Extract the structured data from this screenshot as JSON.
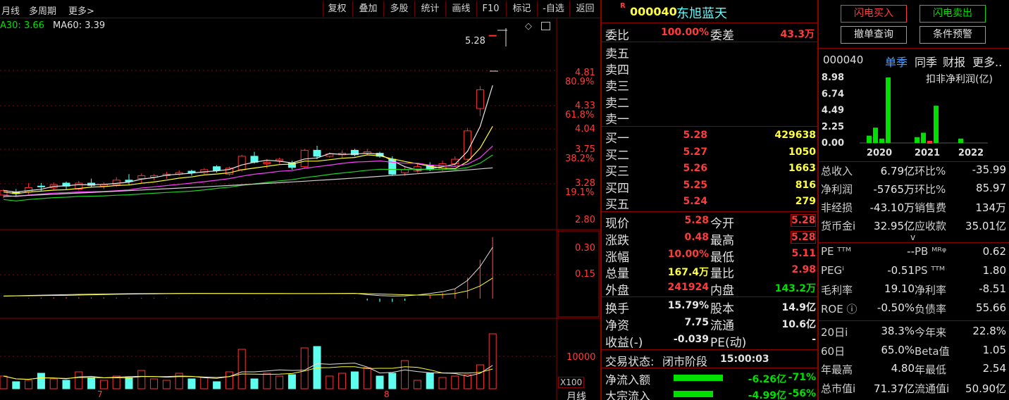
{
  "toolbar": {
    "left": [
      "月线",
      "多周期",
      "更多>"
    ],
    "buttons": [
      "复权",
      "叠加",
      "多股",
      "统计",
      "画线",
      "F10",
      "标记",
      "-自选",
      "返回"
    ]
  },
  "chart": {
    "ma_legend": [
      {
        "label": "A30: 3.66",
        "color": "#00e000"
      },
      {
        "label": "MA60: 3.39",
        "color": "#e0e0e0"
      }
    ],
    "high_mark": "5.28",
    "price_axis": [
      {
        "v": "4.81",
        "p": "80.9%"
      },
      {
        "v": "4.33",
        "p": "61.8%"
      },
      {
        "v": "4.04",
        "p": ""
      },
      {
        "v": "3.75",
        "p": "38.2%"
      },
      {
        "v": "3.28",
        "p": "19.1%"
      },
      {
        "v": "2.80",
        "p": ""
      }
    ],
    "mid_axis": [
      "0.30",
      "0.15"
    ],
    "vol_axis": "10000",
    "vol_unit": "X100",
    "x_labels": [
      "7",
      "8"
    ],
    "period_tag": "月线",
    "colors": {
      "up": "#ff3232",
      "down": "#5ffff0",
      "ma_white": "#e8e8e8",
      "ma_yellow": "#ffff30",
      "ma_magenta": "#ff40ff",
      "ma_green": "#20d020"
    }
  },
  "quote": {
    "badge": "R",
    "code": "000040",
    "name": "东旭蓝天",
    "weibi_label": "委比",
    "weibi_value": "100.00%",
    "weicha_label": "委差",
    "weicha_value": "43.3万",
    "sells": [
      "卖五",
      "卖四",
      "卖三",
      "卖二",
      "卖一"
    ],
    "buys": [
      {
        "label": "买一",
        "price": "5.28",
        "vol": "429638"
      },
      {
        "label": "买二",
        "price": "5.27",
        "vol": "1050"
      },
      {
        "label": "买三",
        "price": "5.26",
        "vol": "1663"
      },
      {
        "label": "买四",
        "price": "5.25",
        "vol": "816"
      },
      {
        "label": "买五",
        "price": "5.24",
        "vol": "279"
      }
    ],
    "stats_left": [
      {
        "k": "现价",
        "v": "5.28"
      },
      {
        "k": "涨跌",
        "v": "0.48"
      },
      {
        "k": "涨幅",
        "v": "10.00%"
      },
      {
        "k": "总量",
        "v": "167.4万"
      },
      {
        "k": "外盘",
        "v": "241924"
      }
    ],
    "stats_right": [
      {
        "k": "今开",
        "v": "5.28"
      },
      {
        "k": "最高",
        "v": "5.28"
      },
      {
        "k": "最低",
        "v": "5.11"
      },
      {
        "k": "量比",
        "v": "2.98"
      },
      {
        "k": "内盘",
        "v": "143.2万"
      }
    ],
    "stats2_left": [
      {
        "k": "换手",
        "v": "15.79%"
      },
      {
        "k": "净资",
        "v": "7.75"
      },
      {
        "k": "收益(-)",
        "v": "-0.039"
      }
    ],
    "stats2_right": [
      {
        "k": "股本",
        "v": "14.9亿"
      },
      {
        "k": "流通",
        "v": "10.6亿"
      },
      {
        "k": "PE(动)",
        "v": "-"
      }
    ],
    "status_label": "交易状态:",
    "status_value": "闭市阶段",
    "status_time": "15:00:03",
    "flows": [
      {
        "k": "净流入额",
        "v": "-6.26亿",
        "p": "-71%"
      },
      {
        "k": "大宗流入",
        "v": "-4.99亿",
        "p": "-56%"
      }
    ]
  },
  "right": {
    "buttons": [
      "闪电买入",
      "闪电卖出",
      "撤单查询",
      "条件预警"
    ],
    "code": "000040",
    "tabs": [
      "单季",
      "同季",
      "财报",
      "更多.."
    ],
    "fin_title": "扣非净利润(亿)",
    "fin_axis": [
      "8.98",
      "6.74",
      "4.49",
      "2.25",
      "0.00"
    ],
    "fin_years": [
      "2020",
      "2021",
      "2022"
    ],
    "fin_bars": [
      {
        "year": "2020",
        "q": 1,
        "value": 1.0
      },
      {
        "year": "2020",
        "q": 2,
        "value": 2.1
      },
      {
        "year": "2020",
        "q": 3,
        "value": 0.6
      },
      {
        "year": "2020",
        "q": 4,
        "value": 8.98
      },
      {
        "year": "2021",
        "q": 1,
        "value": 0.8
      },
      {
        "year": "2021",
        "q": 2,
        "value": 1.4
      },
      {
        "year": "2021",
        "q": 3,
        "value": -0.3
      },
      {
        "year": "2021",
        "q": 4,
        "value": 5.1
      },
      {
        "year": "2022",
        "q": 1,
        "value": 0.6
      }
    ],
    "fin_rows": [
      {
        "k1": "总收入",
        "v1": "6.79亿",
        "k2": "环比%",
        "v2": "-35.99"
      },
      {
        "k1": "净利润",
        "v1": "-5765万",
        "k2": "环比%",
        "v2": "85.97"
      },
      {
        "k1": "非经损",
        "v1": "-43.10万",
        "k2": "销售费",
        "v2": "134万"
      },
      {
        "k1": "货币金i",
        "v1": "32.95亿",
        "k2": "应收款",
        "v2": "35.01亿"
      }
    ],
    "chevron": "v",
    "val_rows": [
      {
        "k1": "PE ᵀᵀᴹ",
        "v1": "--",
        "k2": "PB ᴹᴿᵠ",
        "v2": "0.62"
      },
      {
        "k1": "PEGⁱ",
        "v1": "-0.51",
        "k2": "PS ᵀᵀᴹ",
        "v2": "1.80"
      },
      {
        "k1": "毛利率",
        "v1": "19.10",
        "k2": "净利率",
        "v2": "-8.51"
      },
      {
        "k1": "ROE ⓘ",
        "v1": "-0.50%",
        "k2": "负债率",
        "v2": "55.66"
      }
    ],
    "perf_rows": [
      {
        "k1": "20日i",
        "v1": "38.3%",
        "k2": "今年来",
        "v2": "22.8%"
      },
      {
        "k1": "60日",
        "v1": "65.0%",
        "k2": "Beta值",
        "v2": "1.05"
      },
      {
        "k1": "年最高",
        "v1": "4.80",
        "k2": "年最低",
        "v2": "2.54"
      },
      {
        "k1": "总市值i",
        "v1": "71.37亿",
        "k2": "流通值i",
        "v2": "50.90亿"
      }
    ]
  }
}
